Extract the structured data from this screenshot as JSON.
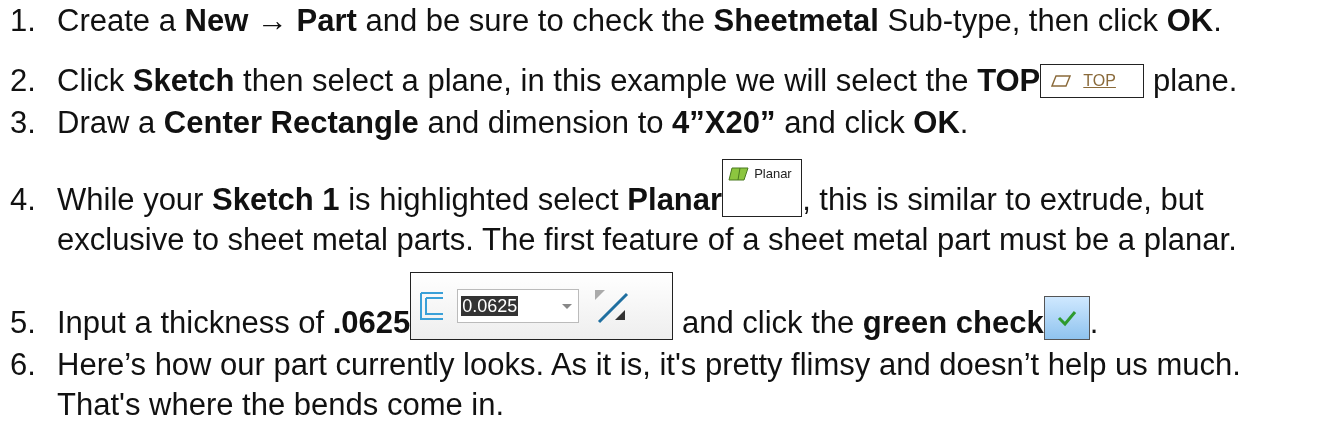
{
  "steps": [
    {
      "number": "1.",
      "parts": [
        {
          "kind": "text",
          "text": "Create a **New** → **Part** and be sure to check the **Sheetmetal** Sub-type, then click **OK**."
        }
      ]
    },
    {
      "number": "2.",
      "parts": [
        {
          "kind": "text",
          "text": "Click **Sketch** then select a plane, in this example we will select the **TOP**"
        },
        {
          "kind": "plane",
          "label": "TOP"
        },
        {
          "kind": "text",
          "text": " plane."
        }
      ]
    },
    {
      "number": "3.",
      "parts": [
        {
          "kind": "text",
          "text": "Draw a **Center Rectangle** and dimension to **4”X20”** and click **OK**."
        }
      ]
    },
    {
      "number": "4.",
      "parts": [
        {
          "kind": "text",
          "text": "While your **Sketch 1** is highlighted select **Planar**"
        },
        {
          "kind": "planar",
          "label": "Planar"
        },
        {
          "kind": "text",
          "text": ", this is similar to extrude, but"
        },
        {
          "kind": "line",
          "text": "exclusive to sheet metal parts. The first feature of a sheet metal part must be a planar."
        }
      ]
    },
    {
      "number": "5.",
      "parts": [
        {
          "kind": "text",
          "text": "Input a thickness of **.0625**"
        },
        {
          "kind": "thickness",
          "value": "0.0625"
        },
        {
          "kind": "text",
          "text": " and click the **green check**"
        },
        {
          "kind": "check"
        },
        {
          "kind": "text",
          "text": "."
        }
      ]
    },
    {
      "number": "6.",
      "parts": [
        {
          "kind": "text",
          "text": "Here’s how our part currently looks. As it is, it's pretty flimsy and doesn’t help us much. That's where the bends come in."
        }
      ]
    }
  ]
}
